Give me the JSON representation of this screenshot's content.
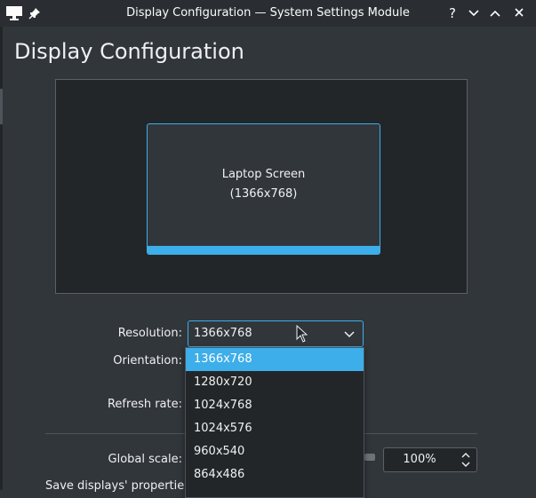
{
  "window": {
    "title": "Display Configuration — System Settings Module",
    "buttons": {
      "help": "?",
      "minimize": "chevron-down-icon",
      "maximize": "chevron-up-icon",
      "close": "×"
    }
  },
  "page": {
    "title": "Display Configuration"
  },
  "preview": {
    "screen_name": "Laptop Screen",
    "screen_resolution": "(1366x768)"
  },
  "form": {
    "resolution_label": "Resolution:",
    "resolution_value": "1366x768",
    "orientation_label": "Orientation:",
    "refresh_label": "Refresh rate:",
    "global_scale_label": "Global scale:",
    "global_scale_value": "100%",
    "save_label": "Save displays' properties:"
  },
  "dropdown": {
    "options": [
      "1366x768",
      "1280x720",
      "1024x768",
      "1024x576",
      "960x540",
      "864x486"
    ],
    "selected": "1366x768"
  },
  "colors": {
    "accent": "#3daee9",
    "background": "#31363b",
    "titlebar": "#2a2e32",
    "dark": "#232629"
  }
}
